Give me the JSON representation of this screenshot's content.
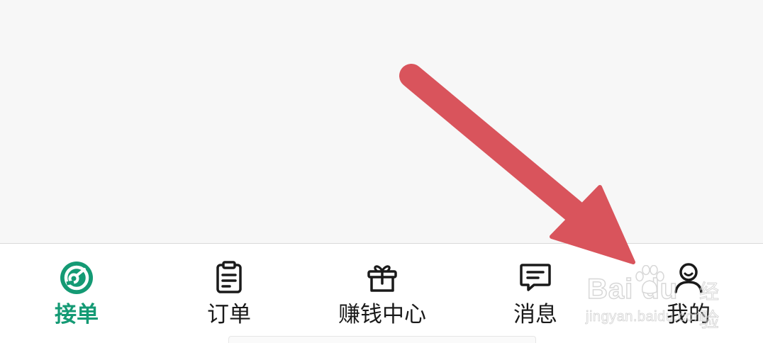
{
  "tabbar": {
    "items": [
      {
        "label": "接单",
        "icon": "radar-icon",
        "active": true
      },
      {
        "label": "订单",
        "icon": "clipboard-icon",
        "active": false
      },
      {
        "label": "赚钱中心",
        "icon": "gift-icon",
        "active": false
      },
      {
        "label": "消息",
        "icon": "message-icon",
        "active": false
      },
      {
        "label": "我的",
        "icon": "user-icon",
        "active": false
      }
    ]
  },
  "colors": {
    "active": "#149a74",
    "text": "#1a1a1a",
    "arrow": "#d9545c",
    "background": "#f7f7f7"
  },
  "watermark": {
    "brand": "Bai du",
    "product": "经验",
    "url": "jingyan.baidu.com"
  }
}
